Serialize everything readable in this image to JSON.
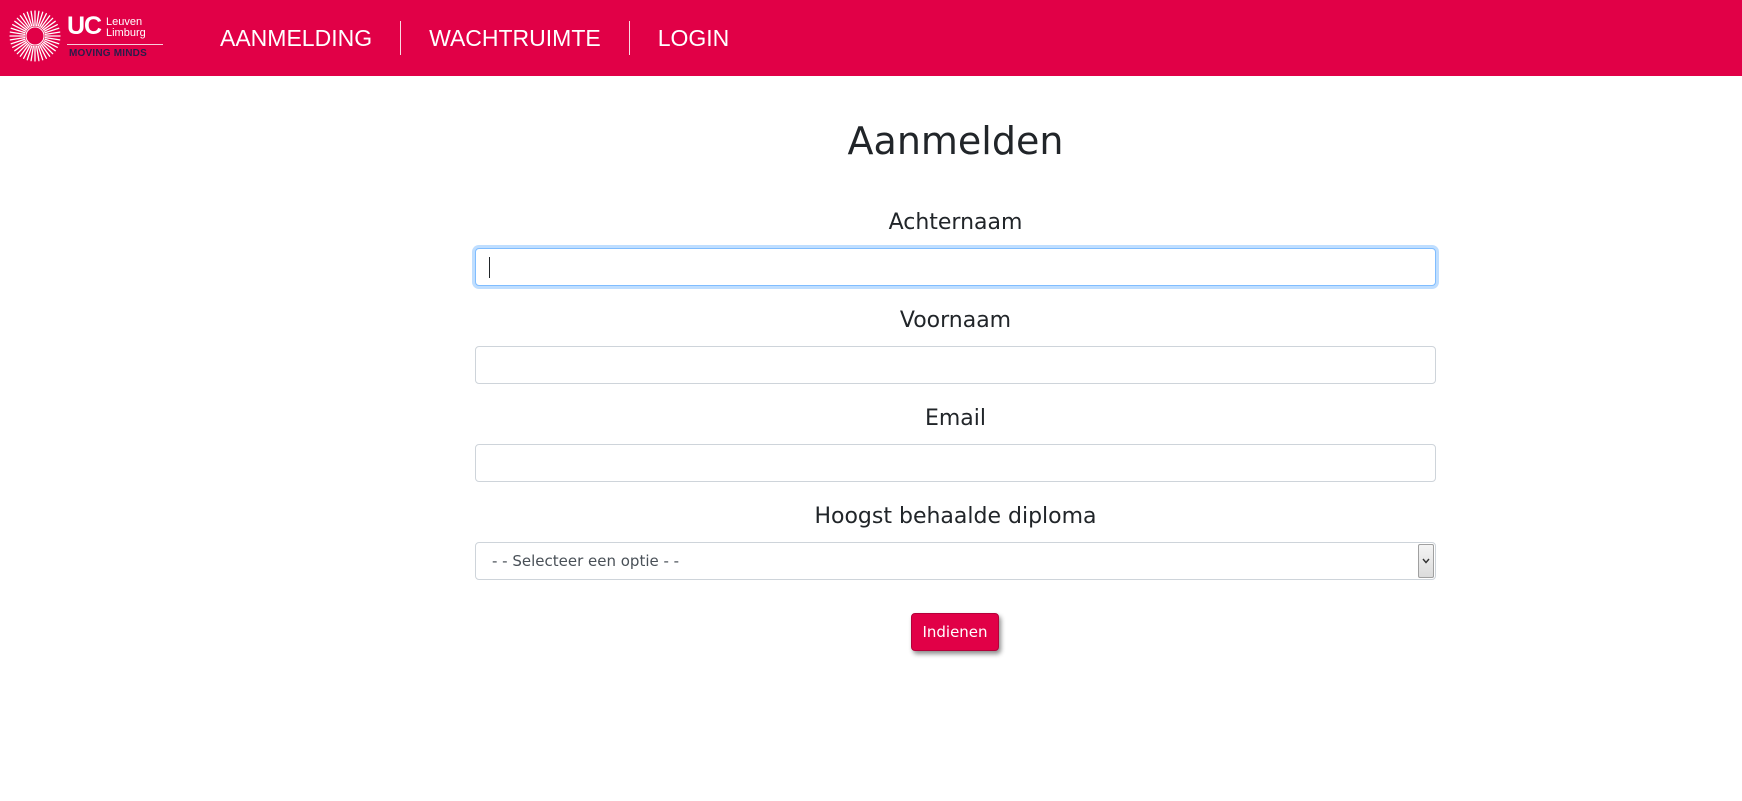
{
  "brand": {
    "logo_name": "UC",
    "logo_place_line1": "Leuven",
    "logo_place_line2": "Limburg",
    "logo_tagline": "MOVING MINDS",
    "accent_color": "#e10047"
  },
  "nav": {
    "items": [
      {
        "label": "AANMELDING"
      },
      {
        "label": "WACHTRUIMTE"
      },
      {
        "label": "LOGIN"
      }
    ]
  },
  "form": {
    "title": "Aanmelden",
    "fields": [
      {
        "label": "Achternaam",
        "value": "",
        "focused": true
      },
      {
        "label": "Voornaam",
        "value": ""
      },
      {
        "label": "Email",
        "value": ""
      }
    ],
    "diploma": {
      "label": "Hoogst behaalde diploma",
      "selected": "- - Selecteer een optie - -"
    },
    "submit_label": "Indienen"
  }
}
